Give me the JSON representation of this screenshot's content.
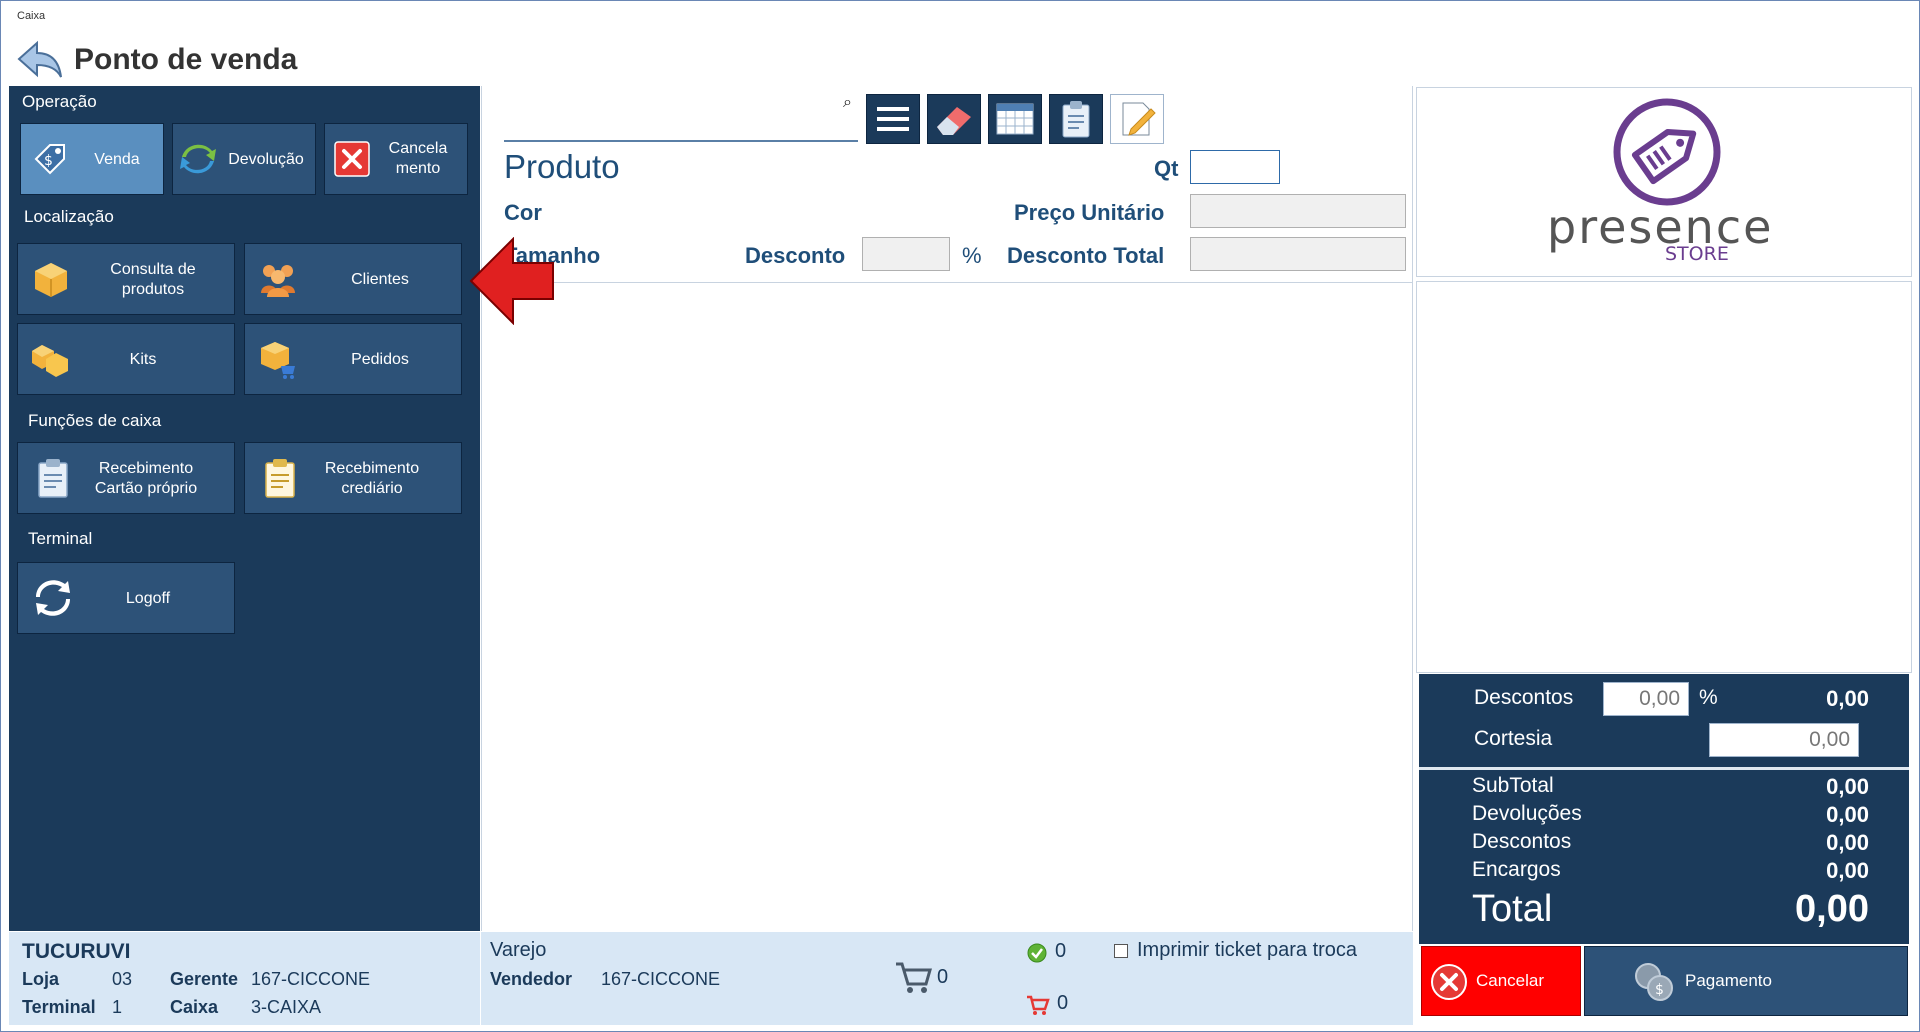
{
  "window": {
    "title": "Caixa"
  },
  "header": {
    "title": "Ponto de venda"
  },
  "sections": {
    "operacao": "Operação",
    "localizacao": "Localização",
    "funcoes": "Funções de caixa",
    "terminal": "Terminal"
  },
  "operation_buttons": [
    {
      "label": "Venda",
      "icon": "price-tag-icon",
      "active": true
    },
    {
      "label": "Devolução",
      "icon": "refresh-arrows-icon",
      "active": false
    },
    {
      "label": "Cancela\nmento",
      "icon": "close-icon",
      "active": false
    }
  ],
  "location_buttons": [
    {
      "label": "Consulta de\nprodutos",
      "icon": "box-icon"
    },
    {
      "label": "Clientes",
      "icon": "users-icon"
    },
    {
      "label": "Kits",
      "icon": "boxes-icon"
    },
    {
      "label": "Pedidos",
      "icon": "box-cart-icon"
    }
  ],
  "cash_buttons": [
    {
      "label": "Recebimento\nCartão próprio",
      "icon": "clipboard-icon"
    },
    {
      "label": "Recebimento\ncrediário",
      "icon": "clipboard-icon"
    }
  ],
  "terminal_buttons": [
    {
      "label": "Logoff",
      "icon": "sync-icon"
    }
  ],
  "search": {
    "value": "",
    "placeholder": ""
  },
  "product_form": {
    "produto_label": "Produto",
    "qt_label": "Qt",
    "qt_value": "",
    "cor_label": "Cor",
    "preco_unitario_label": "Preço Unitário",
    "preco_unitario_value": "",
    "tamanho_label": "Tamanho",
    "desconto_label": "Desconto",
    "desconto_value": "",
    "percent": "%",
    "desconto_total_label": "Desconto Total",
    "desconto_total_value": ""
  },
  "logo": {
    "brand": "presence",
    "sub": "STORE",
    "color": "#6a3d8f"
  },
  "totals": {
    "descontos_label": "Descontos",
    "descontos_input": "0,00",
    "percent": "%",
    "descontos_value": "0,00",
    "cortesia_label": "Cortesia",
    "cortesia_input": "0,00",
    "subtotal_label": "SubTotal",
    "subtotal_value": "0,00",
    "devolucoes_label": "Devoluções",
    "devolucoes_value": "0,00",
    "descontos2_label": "Descontos",
    "descontos2_value": "0,00",
    "encargos_label": "Encargos",
    "encargos_value": "0,00",
    "total_label": "Total",
    "total_value": "0,00"
  },
  "actions": {
    "cancelar": "Cancelar",
    "pagamento": "Pagamento"
  },
  "footer_left": {
    "store": "TUCURUVI",
    "loja_label": "Loja",
    "loja_value": "03",
    "gerente_label": "Gerente",
    "gerente_value": "167-CICCONE",
    "terminal_label": "Terminal",
    "terminal_value": "1",
    "caixa_label": "Caixa",
    "caixa_value": "3-CAIXA"
  },
  "footer_center": {
    "mode": "Varejo",
    "vendedor_label": "Vendedor",
    "vendedor_value": "167-CICCONE",
    "cart_count": "0",
    "ok_count": "0",
    "cart2_count": "0",
    "print_ticket_label": "Imprimir ticket para troca"
  },
  "colors": {
    "panel": "#1b3a5a",
    "tile": "#2d5278",
    "active": "#5a8fbf",
    "label": "#1f4e79",
    "cancel": "#ff0000"
  }
}
